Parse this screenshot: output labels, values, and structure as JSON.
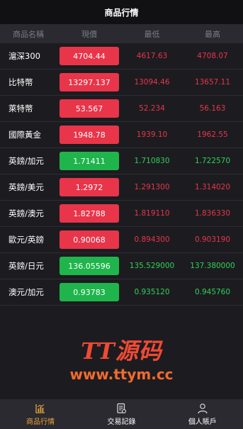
{
  "header": {
    "title": "商品行情"
  },
  "columns": {
    "name": "商品名稱",
    "price": "現價",
    "low": "最低",
    "high": "最高"
  },
  "rows": [
    {
      "name": "滬深300",
      "price": "4704.44",
      "trend": "up",
      "low": "4617.63",
      "high": "4708.07"
    },
    {
      "name": "比特幣",
      "price": "13297.137",
      "trend": "up",
      "low": "13094.46",
      "high": "13657.11"
    },
    {
      "name": "萊特幣",
      "price": "53.567",
      "trend": "up",
      "low": "52.234",
      "high": "56.163"
    },
    {
      "name": "國際黃金",
      "price": "1948.78",
      "trend": "up",
      "low": "1939.10",
      "high": "1962.55"
    },
    {
      "name": "英鎊/加元",
      "price": "1.71411",
      "trend": "down",
      "low": "1.710830",
      "high": "1.722570"
    },
    {
      "name": "英鎊/美元",
      "price": "1.2972",
      "trend": "up",
      "low": "1.291300",
      "high": "1.314020"
    },
    {
      "name": "英鎊/澳元",
      "price": "1.82788",
      "trend": "up",
      "low": "1.819110",
      "high": "1.836330"
    },
    {
      "name": "歐元/英鎊",
      "price": "0.90068",
      "trend": "up",
      "low": "0.894300",
      "high": "0.903190"
    },
    {
      "name": "英鎊/日元",
      "price": "136.05596",
      "trend": "down",
      "low": "135.529000",
      "high": "137.380000"
    },
    {
      "name": "澳元/加元",
      "price": "0.93783",
      "trend": "down",
      "low": "0.935120",
      "high": "0.945760"
    }
  ],
  "watermark": {
    "logo": "TT源码",
    "url": "www.ttym.cc"
  },
  "tabs": [
    {
      "label": "商品行情",
      "icon": "chart-icon",
      "active": true
    },
    {
      "label": "交易記錄",
      "icon": "document-icon",
      "active": false
    },
    {
      "label": "個人賬戶",
      "icon": "user-icon",
      "active": false
    }
  ],
  "colors": {
    "up": "#e8354a",
    "down": "#1fb54c",
    "active_tab": "#e8a33a",
    "watermark": "#ef4a35"
  }
}
